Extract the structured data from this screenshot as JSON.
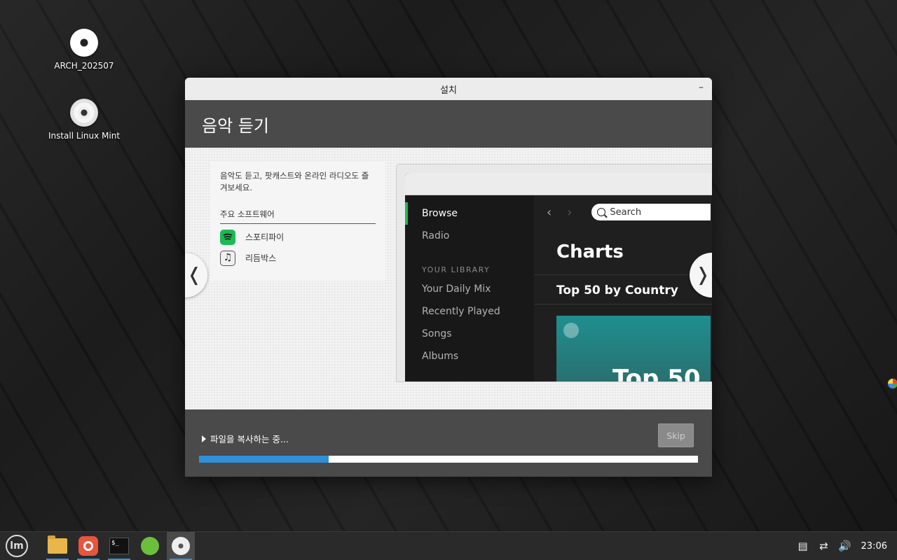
{
  "desktop": {
    "icons": [
      {
        "label": "ARCH_202507",
        "icon": "disc-icon"
      },
      {
        "label": "Install Linux Mint",
        "icon": "disc-icon"
      }
    ]
  },
  "window": {
    "title": "설치",
    "minimize_glyph": "–",
    "header": "음악 듣기"
  },
  "slide": {
    "description": "음악도 듣고, 팟캐스트와 온라인 라디오도 즐겨보세요.",
    "software_heading": "주요 소프트웨어",
    "software": [
      {
        "name": "스포티파이",
        "icon": "spotify-icon"
      },
      {
        "name": "리듬박스",
        "icon": "music-note-icon"
      }
    ],
    "prev_glyph": "❬",
    "next_glyph": "❭"
  },
  "spotify": {
    "sidebar": [
      "Browse",
      "Radio"
    ],
    "library_heading": "YOUR LIBRARY",
    "library": [
      "Your Daily Mix",
      "Recently Played",
      "Songs",
      "Albums"
    ],
    "search_placeholder": "Search",
    "charts_title": "Charts",
    "section_title": "Top 50 by Country",
    "tile_text": "Top 50",
    "accent_color": "#1db954"
  },
  "progress": {
    "label": "파일을 복사하는 중...",
    "fraction": 0.26,
    "skip_label": "Skip",
    "bar_color": "#2f8fd8"
  },
  "taskbar": {
    "apps": [
      "mint-menu-icon",
      "files-folder-icon",
      "firefox-icon",
      "terminal-icon",
      "apps-grid-icon",
      "installer-disc-icon"
    ],
    "terminal_text": "$_",
    "mint_text": "lm",
    "clock": "23:06"
  }
}
